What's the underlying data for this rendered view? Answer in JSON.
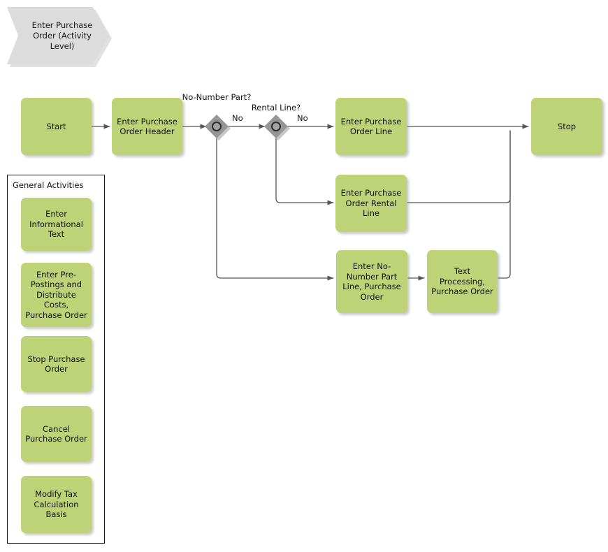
{
  "diagram": {
    "title": "Enter Purchase Order (Activity Level)",
    "accent_color": "#bed278",
    "gateway_color": "#969696",
    "title_shape_color": "#dcdcdc",
    "connector_color": "#555555"
  },
  "header": {
    "label": "Enter Purchase Order (Activity Level)"
  },
  "flow": {
    "nodes": [
      {
        "id": "start",
        "label": "Start"
      },
      {
        "id": "po_header",
        "label": "Enter Purchase Order Header"
      },
      {
        "id": "po_line",
        "label": "Enter Purchase Order Line"
      },
      {
        "id": "po_rental_line",
        "label": "Enter Purchase Order Rental Line"
      },
      {
        "id": "no_number_part_line",
        "label": "Enter No-Number Part Line, Purchase Order"
      },
      {
        "id": "text_processing",
        "label": "Text Processing, Purchase Order"
      },
      {
        "id": "stop",
        "label": "Stop"
      }
    ],
    "gateways": [
      {
        "id": "gw_no_number_part",
        "title": "No-Number Part?",
        "out_label": "No"
      },
      {
        "id": "gw_rental_line",
        "title": "Rental Line?",
        "out_label": "No"
      }
    ]
  },
  "group": {
    "title": "General Activities",
    "items": [
      {
        "id": "informational_text",
        "label": "Enter Informational Text"
      },
      {
        "id": "pre_postings",
        "label": "Enter Pre-Postings and Distribute Costs, Purchase Order"
      },
      {
        "id": "stop_po",
        "label": "Stop Purchase Order"
      },
      {
        "id": "cancel_po",
        "label": "Cancel Purchase Order"
      },
      {
        "id": "modify_tax",
        "label": "Modify Tax Calculation Basis"
      }
    ]
  }
}
